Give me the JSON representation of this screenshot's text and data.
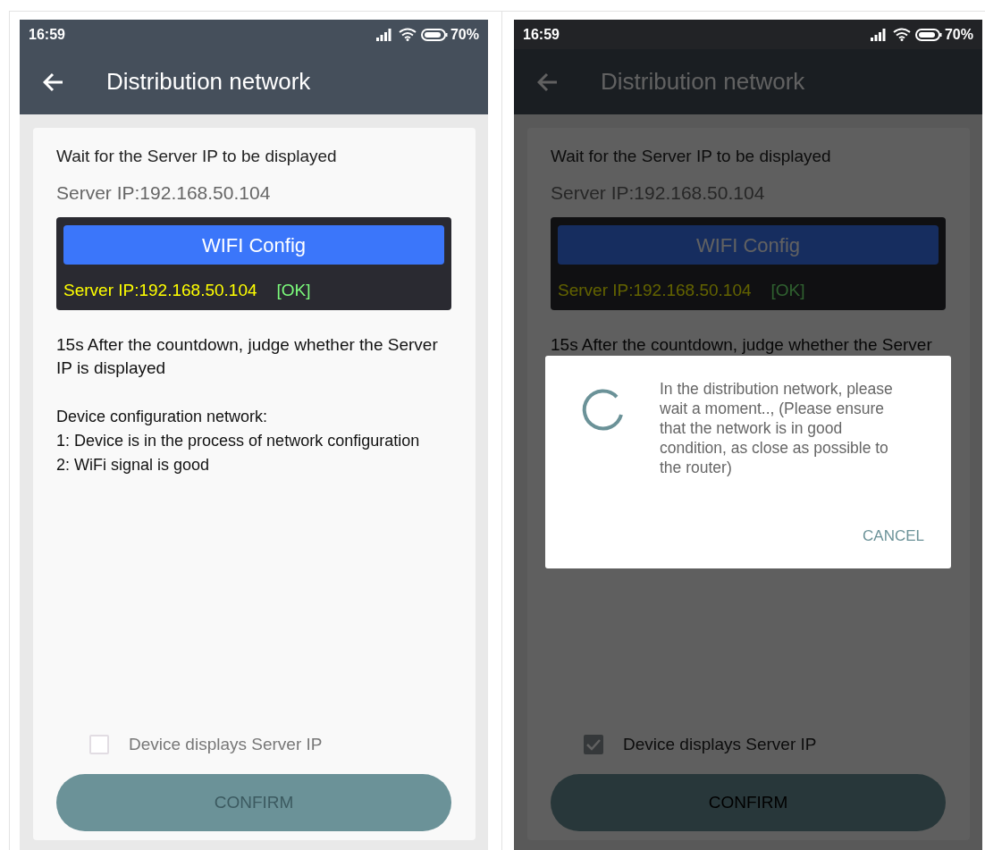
{
  "screens": [
    {
      "status_bar": {
        "time": "16:59",
        "battery": "70%"
      },
      "title": "Distribution network",
      "dimmed": false,
      "card": {
        "heading": "Wait for the Server IP to be displayed",
        "server_ip": "Server IP:192.168.50.104",
        "console": {
          "button": "WIFI Config",
          "ip_line": "Server IP:192.168.50.104",
          "status": "[OK]"
        },
        "notes": [
          "15s After the countdown, judge whether the Server IP is displayed"
        ],
        "config": [
          "Device configuration network:",
          "1: Device is in the process of network configuration",
          "2: WiFi signal is good"
        ]
      },
      "checkbox": {
        "label": "Device displays Server IP",
        "checked": false
      },
      "confirm": {
        "label": "CONFIRM",
        "disabled": true
      }
    },
    {
      "status_bar": {
        "time": "16:59",
        "battery": "70%"
      },
      "title": "Distribution network",
      "dimmed": true,
      "card": {
        "heading": "Wait for the Server IP to be displayed",
        "server_ip": "Server IP:192.168.50.104",
        "console": {
          "button": "WIFI Config",
          "ip_line": "Server IP:192.168.50.104",
          "status": "[OK]"
        },
        "notes": [
          "15s After the countdown, judge whether the Server"
        ]
      },
      "checkbox": {
        "label": "Device displays Server IP",
        "checked": true
      },
      "confirm": {
        "label": "CONFIRM",
        "disabled": false
      },
      "dialog": {
        "message": "In the distribution network, please wait a moment.., (Please ensure that the network is in good condition, as close as possible to the router)",
        "cancel": "CANCEL"
      }
    }
  ]
}
